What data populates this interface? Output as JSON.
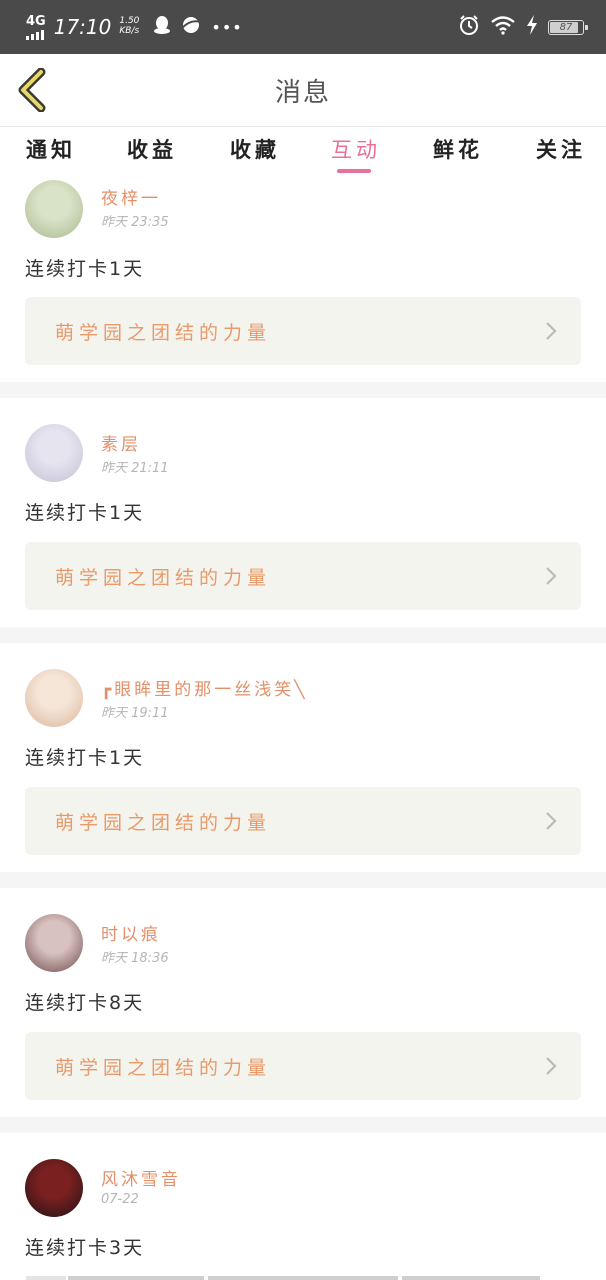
{
  "status_bar": {
    "network": "4G",
    "time": "17:10",
    "speed_value": "1.50",
    "speed_unit": "KB/s",
    "more": "•••",
    "battery_level": "87"
  },
  "header": {
    "title": "消息"
  },
  "tabs": [
    {
      "label": "通知"
    },
    {
      "label": "收益"
    },
    {
      "label": "收藏"
    },
    {
      "label": "互动",
      "active": true
    },
    {
      "label": "鲜花"
    },
    {
      "label": "关注"
    }
  ],
  "feed": [
    {
      "username": "夜梓一",
      "time": "昨天  23:35",
      "checkin": "连续打卡1天",
      "post_title": "萌学园之团结的力量",
      "avatar_colors": [
        "#d9e3c8",
        "#a8b98d"
      ]
    },
    {
      "username": "素层",
      "time": "昨天  21:11",
      "checkin": "连续打卡1天",
      "post_title": "萌学园之团结的力量",
      "avatar_colors": [
        "#e6e4ef",
        "#c3bfd4"
      ]
    },
    {
      "username": "┏眼眸里的那一丝浅笑╲",
      "time": "昨天  19:11",
      "checkin": "连续打卡1天",
      "post_title": "萌学园之团结的力量",
      "avatar_colors": [
        "#f6e6d8",
        "#d9b59a"
      ]
    },
    {
      "username": "时以痕",
      "time": "昨天  18:36",
      "checkin": "连续打卡8天",
      "post_title": "萌学园之团结的力量",
      "avatar_colors": [
        "#d8c2c0",
        "#6d4a4c"
      ]
    },
    {
      "username": "风沐雪音",
      "time": "07-22",
      "checkin": "连续打卡3天",
      "avatar_colors": [
        "#7a2020",
        "#1e1214"
      ]
    }
  ]
}
